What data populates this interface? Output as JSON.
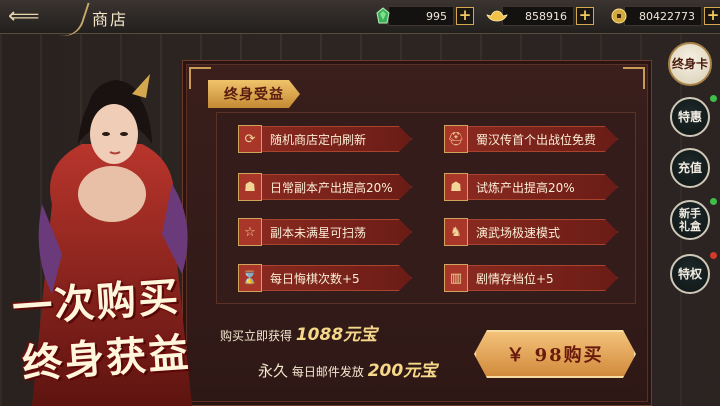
{
  "header": {
    "title": "商店",
    "currencies": [
      {
        "icon": "jade-icon",
        "value": "995"
      },
      {
        "icon": "gold-ingot-icon",
        "value": "858916"
      },
      {
        "icon": "coin-icon",
        "value": "80422773"
      }
    ]
  },
  "hero": {
    "slogan_line1": "一次购买",
    "slogan_line2": "终身获益"
  },
  "panel": {
    "section_title": "终身受益",
    "benefits": [
      {
        "icon": "refresh-icon",
        "label": "随机商店定向刷新"
      },
      {
        "icon": "helmet-icon",
        "label": "蜀汉传首个出战位免费"
      },
      {
        "icon": "money-bag-icon",
        "label": "日常副本产出提高20%"
      },
      {
        "icon": "money-bag-icon",
        "label": "试炼产出提高20%"
      },
      {
        "icon": "star-icon",
        "label": "副本未满星可扫荡"
      },
      {
        "icon": "horse-icon",
        "label": "演武场极速模式"
      },
      {
        "icon": "hourglass-icon",
        "label": "每日悔棋次数+5"
      },
      {
        "icon": "book-icon",
        "label": "剧情存档位+5"
      }
    ],
    "purchase": {
      "line1_prefix": "购买立即获得",
      "line1_amount": "1088元宝",
      "line2_prefix": "永久",
      "line2_middle": "每日邮件发放",
      "line2_amount": "200元宝"
    },
    "buy_button": "￥ 98购买"
  },
  "side_nav": [
    {
      "label": "终身卡",
      "active": true
    },
    {
      "label": "特惠",
      "active": false
    },
    {
      "label": "充值",
      "active": false
    },
    {
      "label": "新手礼盒",
      "active": false
    },
    {
      "label": "特权",
      "active": false
    }
  ]
}
